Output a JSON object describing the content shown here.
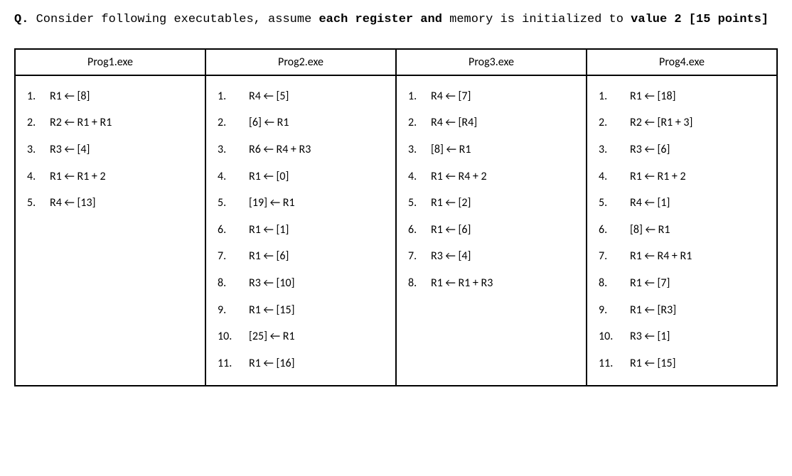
{
  "question": {
    "label": "Q.",
    "pre": " Consider following executables, assume ",
    "bold1": "each register and",
    "mid": " memory is initialized to ",
    "bold2": "value 2 [15 points]"
  },
  "arrow": "←",
  "columns": [
    {
      "title": "Prog1.exe",
      "klass": "prog1",
      "instructions": [
        "R1 ← [8]",
        "R2 ← R1 + R1",
        "R3 ← [4]",
        "R1 ← R1 + 2",
        "R4 ← [13]"
      ]
    },
    {
      "title": "Prog2.exe",
      "klass": "prog2",
      "instructions": [
        "R4 ← [5]",
        "[6] ← R1",
        "R6 ← R4 + R3",
        "R1 ← [0]",
        "[19] ← R1",
        "R1 ← [1]",
        "R1 ← [6]",
        "R3 ← [10]",
        "R1 ← [15]",
        "[25] ← R1",
        "R1 ← [16]"
      ]
    },
    {
      "title": "Prog3.exe",
      "klass": "prog3",
      "instructions": [
        "R4 ← [7]",
        "R4 ← [R4]",
        "[8] ← R1",
        "R1 ← R4 + 2",
        "R1 ← [2]",
        "R1 ← [6]",
        "R3 ← [4]",
        "R1 ← R1 + R3"
      ]
    },
    {
      "title": "Prog4.exe",
      "klass": "prog4",
      "instructions": [
        "R1 ← [18]",
        "R2 ← [R1 + 3]",
        "R3 ← [6]",
        "R1 ← R1 + 2",
        "R4 ← [1]",
        "[8] ← R1",
        "R1 ← R4 + R1",
        "R1 ← [7]",
        "R1 ← [R3]",
        "R3 ← [1]",
        "R1 ← [15]"
      ]
    }
  ]
}
